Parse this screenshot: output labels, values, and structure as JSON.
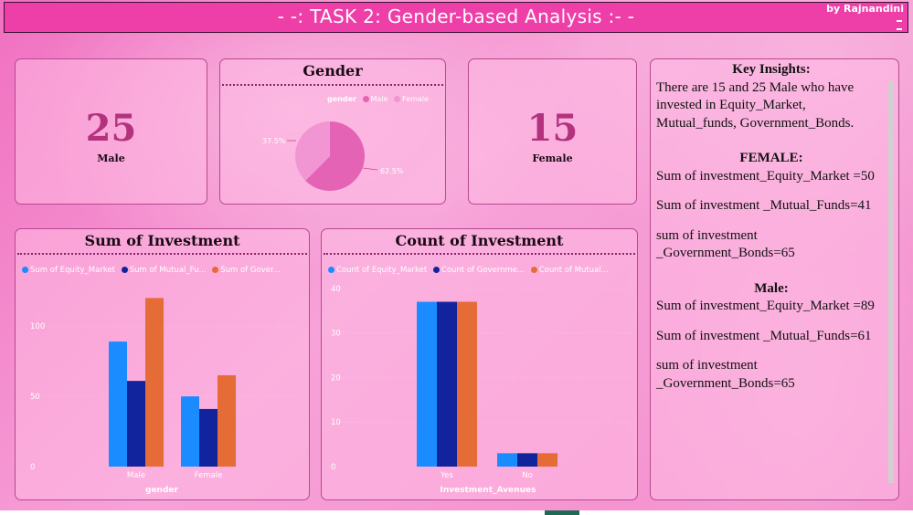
{
  "header": {
    "title": "- -: TASK 2: Gender-based Analysis :- -",
    "author": "by Rajnandini"
  },
  "cards": {
    "male": {
      "value": "25",
      "label": "Male"
    },
    "female": {
      "value": "15",
      "label": "Female"
    }
  },
  "gender_chart": {
    "title": "Gender",
    "legend_title": "gender",
    "legend": [
      "Male",
      "Female"
    ],
    "male_pct_label": "62.5%",
    "female_pct_label": "37.5%"
  },
  "sum_chart": {
    "title": "Sum of Investment",
    "legend": [
      "Sum of Equity_Market",
      "Sum of Mutual_Fu...",
      "Sum of Gover..."
    ],
    "xlabel": "gender"
  },
  "count_chart": {
    "title": "Count of Investment",
    "legend": [
      "Count of Equity_Market",
      "Count of Governme...",
      "Count of Mutual..."
    ],
    "xlabel": "Investment_Avenues"
  },
  "insights": {
    "title": "Key Insights:",
    "intro": "There are 15 and 25 Male who have invested in Equity_Market, Mutual_funds, Government_Bonds.",
    "female_heading": "FEMALE:",
    "female_lines": [
      "Sum of investment_Equity_Market =50",
      "Sum of investment _Mutual_Funds=41",
      "sum of investment _Government_Bonds=65"
    ],
    "male_heading": "Male:",
    "male_lines": [
      "Sum of investment_Equity_Market =89",
      "Sum of investment _Mutual_Funds=61",
      "sum of investment _Government_Bonds=65"
    ]
  },
  "colors": {
    "series_blue": "#1a8cff",
    "series_navy": "#12239e",
    "series_orange": "#e66c37",
    "pie_male": "#e563b5",
    "pie_female": "#f196d2",
    "accent_number": "#b2327d"
  },
  "chart_data": [
    {
      "type": "pie",
      "title": "Gender",
      "categories": [
        "Male",
        "Female"
      ],
      "values": [
        62.5,
        37.5
      ]
    },
    {
      "type": "bar",
      "title": "Sum of Investment",
      "categories": [
        "Male",
        "Female"
      ],
      "series": [
        {
          "name": "Sum of Equity_Market",
          "values": [
            89,
            50
          ]
        },
        {
          "name": "Sum of Mutual_Fu...",
          "values": [
            61,
            41
          ]
        },
        {
          "name": "Sum of Gover...",
          "values": [
            120,
            65
          ]
        }
      ],
      "xlabel": "gender",
      "yticks": [
        0,
        50,
        100
      ],
      "ylim": [
        0,
        130
      ]
    },
    {
      "type": "bar",
      "title": "Count of Investment",
      "categories": [
        "Yes",
        "No"
      ],
      "series": [
        {
          "name": "Count of Equity_Market",
          "values": [
            37,
            3
          ]
        },
        {
          "name": "Count of Governme...",
          "values": [
            37,
            3
          ]
        },
        {
          "name": "Count of Mutual...",
          "values": [
            37,
            3
          ]
        }
      ],
      "xlabel": "Investment_Avenues",
      "yticks": [
        0,
        10,
        20,
        30,
        40
      ],
      "ylim": [
        0,
        41
      ]
    }
  ]
}
